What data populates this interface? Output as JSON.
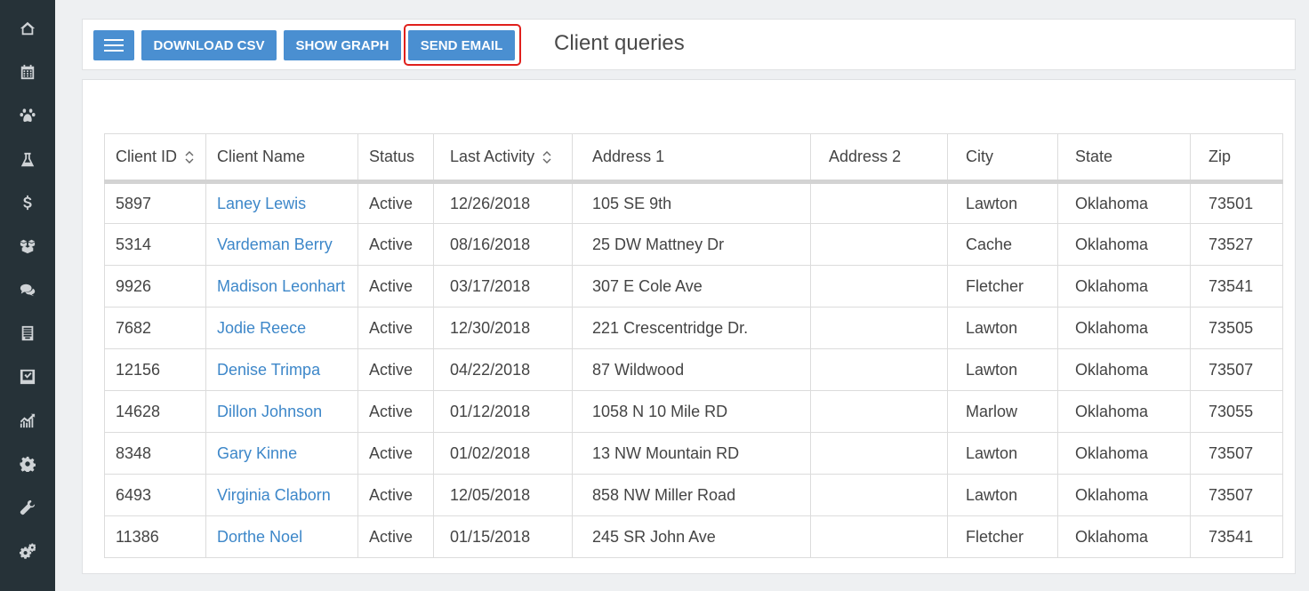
{
  "sidebar": {
    "items": [
      {
        "id": "home",
        "icon": "home-icon"
      },
      {
        "id": "calendar",
        "icon": "calendar-icon"
      },
      {
        "id": "pets",
        "icon": "paw-icon"
      },
      {
        "id": "lab",
        "icon": "flask-icon"
      },
      {
        "id": "billing",
        "icon": "dollar-icon"
      },
      {
        "id": "inventory",
        "icon": "boxes-icon"
      },
      {
        "id": "messages",
        "icon": "chat-bubbles-icon"
      },
      {
        "id": "reports",
        "icon": "document-list-icon"
      },
      {
        "id": "tasks",
        "icon": "checkbox-icon"
      },
      {
        "id": "analytics",
        "icon": "chart-growth-icon"
      },
      {
        "id": "settings",
        "icon": "gear-icon"
      },
      {
        "id": "tools",
        "icon": "wrench-icon"
      },
      {
        "id": "admin",
        "icon": "gears-icon"
      }
    ]
  },
  "toolbar": {
    "menu_icon": "hamburger-icon",
    "download_csv_label": "DOWNLOAD CSV",
    "show_graph_label": "SHOW GRAPH",
    "send_email_label": "SEND EMAIL",
    "title": "Client queries",
    "highlight_color": "#e0201c",
    "button_color": "#4a8fd1"
  },
  "table": {
    "columns": [
      {
        "label": "Client ID",
        "sortable": true
      },
      {
        "label": "Client Name",
        "sortable": false
      },
      {
        "label": "Status",
        "sortable": false
      },
      {
        "label": "Last Activity",
        "sortable": true
      },
      {
        "label": "Address 1",
        "sortable": false
      },
      {
        "label": "Address 2",
        "sortable": false
      },
      {
        "label": "City",
        "sortable": false
      },
      {
        "label": "State",
        "sortable": false
      },
      {
        "label": "Zip",
        "sortable": false
      }
    ],
    "rows": [
      {
        "id": "5897",
        "name": "Laney Lewis",
        "status": "Active",
        "last_activity": "12/26/2018",
        "address1": "105  SE 9th",
        "address2": "",
        "city": "Lawton",
        "state": "Oklahoma",
        "zip": "73501"
      },
      {
        "id": "5314",
        "name": "Vardeman Berry",
        "status": "Active",
        "last_activity": "08/16/2018",
        "address1": "25 DW  Mattney Dr",
        "address2": "",
        "city": "Cache",
        "state": "Oklahoma",
        "zip": "73527"
      },
      {
        "id": "9926",
        "name": "Madison Leonhart",
        "status": "Active",
        "last_activity": "03/17/2018",
        "address1": "307  E Cole Ave",
        "address2": "",
        "city": "Fletcher",
        "state": "Oklahoma",
        "zip": "73541"
      },
      {
        "id": "7682",
        "name": "Jodie Reece",
        "status": "Active",
        "last_activity": "12/30/2018",
        "address1": "221  Crescentridge Dr.",
        "address2": "",
        "city": "Lawton",
        "state": "Oklahoma",
        "zip": "73505"
      },
      {
        "id": "12156",
        "name": "Denise Trimpa",
        "status": "Active",
        "last_activity": "04/22/2018",
        "address1": "87  Wildwood",
        "address2": "",
        "city": "Lawton",
        "state": "Oklahoma",
        "zip": "73507"
      },
      {
        "id": "14628",
        "name": "Dillon Johnson",
        "status": "Active",
        "last_activity": "01/12/2018",
        "address1": "1058  N 10 Mile RD",
        "address2": "",
        "city": "Marlow",
        "state": "Oklahoma",
        "zip": "73055"
      },
      {
        "id": "8348",
        "name": "Gary Kinne",
        "status": "Active",
        "last_activity": "01/02/2018",
        "address1": "13 NW Mountain RD",
        "address2": "",
        "city": "Lawton",
        "state": "Oklahoma",
        "zip": "73507"
      },
      {
        "id": "6493",
        "name": "Virginia Claborn",
        "status": "Active",
        "last_activity": "12/05/2018",
        "address1": "858 NW Miller Road",
        "address2": "",
        "city": "Lawton",
        "state": "Oklahoma",
        "zip": "73507"
      },
      {
        "id": "11386",
        "name": "Dorthe Noel",
        "status": "Active",
        "last_activity": "01/15/2018",
        "address1": "245  SR John Ave",
        "address2": "",
        "city": "Fletcher",
        "state": "Oklahoma",
        "zip": "73541"
      }
    ]
  }
}
